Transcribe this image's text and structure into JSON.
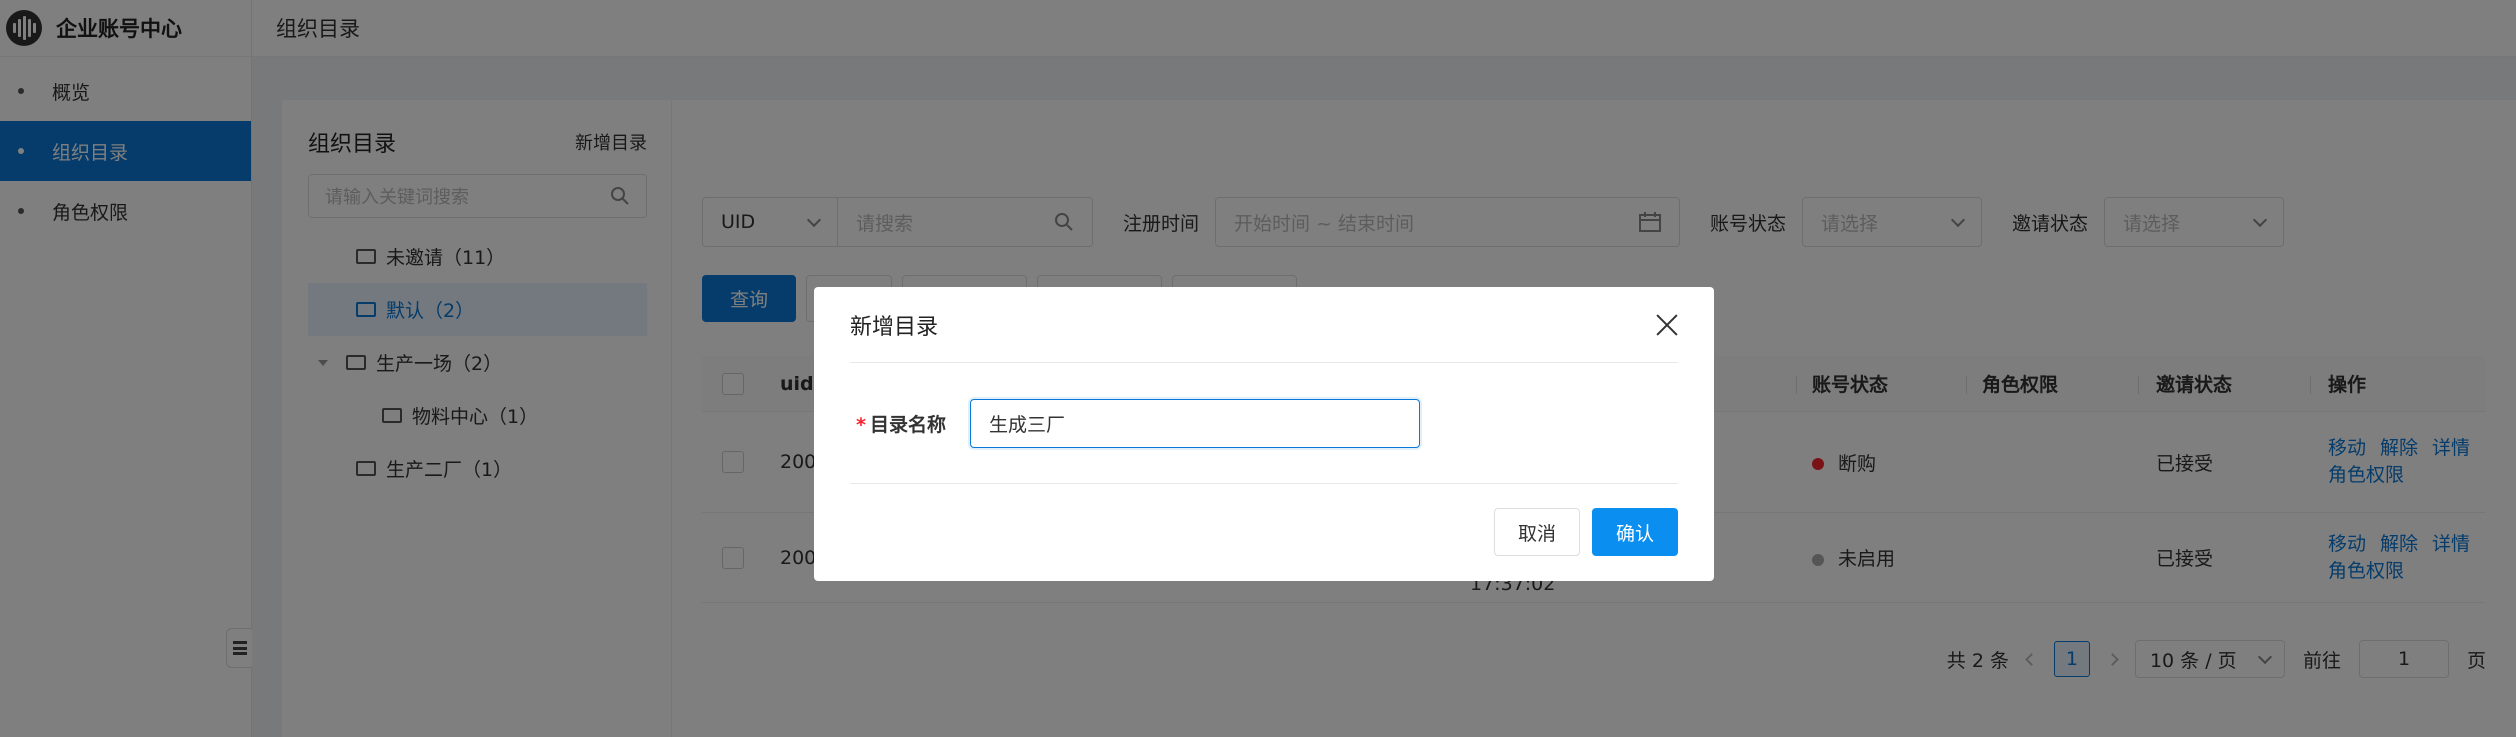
{
  "app": {
    "title": "企业账号中心"
  },
  "sidebar": {
    "items": [
      {
        "label": "概览"
      },
      {
        "label": "组织目录"
      },
      {
        "label": "角色权限"
      }
    ]
  },
  "header": {
    "title": "组织目录"
  },
  "tree": {
    "title": "组织目录",
    "new_label": "新增目录",
    "search_placeholder": "请输入关键词搜索",
    "nodes": [
      {
        "label": "未邀请（11）"
      },
      {
        "label": "默认（2）"
      },
      {
        "label": "生产一场（2）"
      },
      {
        "label": "物料中心（1）"
      },
      {
        "label": "生产二厂（1）"
      }
    ]
  },
  "filters": {
    "field_select": "UID",
    "search_placeholder": "请搜索",
    "reg_time_label": "注册时间",
    "reg_time_placeholder": "开始时间 ~ 结束时间",
    "account_status_label": "账号状态",
    "account_status_placeholder": "请选择",
    "invite_status_label": "邀请状态",
    "invite_status_placeholder": "请选择",
    "query_label": "查询"
  },
  "table": {
    "headers": {
      "uid": "uid",
      "account_status": "账号状态",
      "role": "角色权限",
      "invite_status": "邀请状态",
      "ops": "操作"
    },
    "rows": [
      {
        "uid": "200",
        "time": "",
        "status": "断购",
        "status_color": "#f5222d",
        "invite": "已接受"
      },
      {
        "uid": "200",
        "time": "17:37:02",
        "status": "未启用",
        "status_color": "#aaaaaa",
        "invite": "已接受"
      }
    ],
    "ops": {
      "move": "移动",
      "remove": "解除",
      "detail": "详情",
      "role": "角色权限"
    }
  },
  "pager": {
    "total": "共 2 条",
    "page": "1",
    "size": "10 条 / 页",
    "goto": "前往",
    "goto_value": "1",
    "page_unit": "页"
  },
  "modal": {
    "title": "新增目录",
    "required_mark": "*",
    "field_label": "目录名称",
    "field_value": "生成三厂",
    "cancel": "取消",
    "confirm": "确认"
  },
  "colors": {
    "accent": "#0a78d7"
  }
}
